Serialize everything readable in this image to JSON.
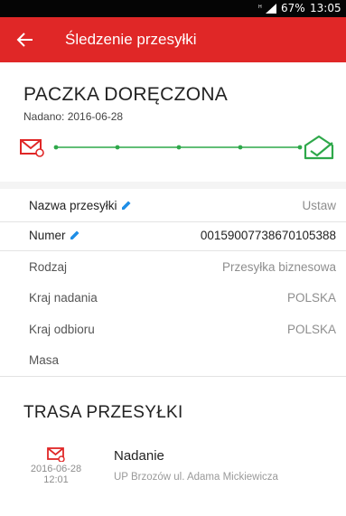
{
  "status_bar": {
    "battery": "67%",
    "time": "13:05",
    "icons": [
      "signal-icon",
      "battery-icon"
    ]
  },
  "app_bar": {
    "title": "Śledzenie przesyłki",
    "back_icon": "back-arrow-icon"
  },
  "summary": {
    "status": "PACZKA DORĘCZONA",
    "sent_date": "Nadano: 2016-06-28"
  },
  "tracker": {
    "start_icon": "envelope-sent-icon",
    "end_icon": "envelope-delivered-icon",
    "colors": {
      "start": "#e02727",
      "line": "#2ea84a"
    }
  },
  "details": {
    "parcel_name": {
      "label": "Nazwa przesyłki",
      "value": "Ustaw"
    },
    "number": {
      "label": "Numer",
      "value": "00159007738670105388"
    },
    "rows": [
      {
        "label": "Rodzaj",
        "value": "Przesyłka biznesowa"
      },
      {
        "label": "Kraj nadania",
        "value": "POLSKA"
      },
      {
        "label": "Kraj odbioru",
        "value": "POLSKA"
      },
      {
        "label": "Masa",
        "value": ""
      }
    ]
  },
  "route": {
    "title": "TRASA PRZESYŁKI",
    "events": [
      {
        "icon": "envelope-sent-icon",
        "date": "2016-06-28",
        "time": "12:01",
        "title": "Nadanie",
        "place": "UP Brzozów ul. Adama Mickiewicza"
      }
    ]
  },
  "colors": {
    "accent": "#e02727",
    "success": "#2ea84a",
    "edit": "#1f8ee6"
  }
}
